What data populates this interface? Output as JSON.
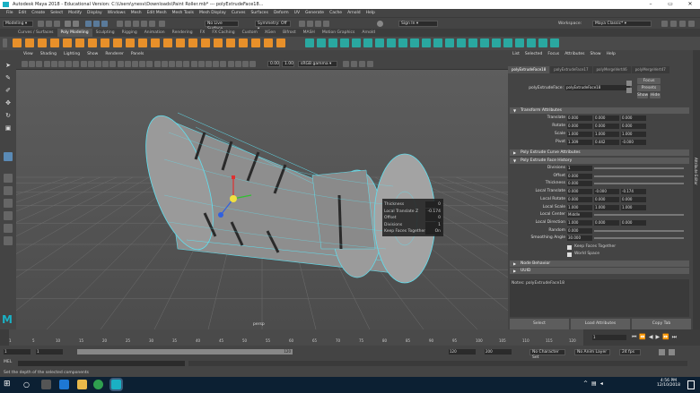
{
  "window": {
    "title": "Autodesk Maya 2018 - Educational Version: C:\\Users\\ynesv\\Downloads\\Paint Roller.mb* --- polyExtrudeFace18..."
  },
  "menubar": [
    "File",
    "Edit",
    "Create",
    "Select",
    "Modify",
    "Display",
    "Windows",
    "Mesh",
    "Edit Mesh",
    "Mesh Tools",
    "Mesh Display",
    "Curves",
    "Surfaces",
    "Deform",
    "UV",
    "Generate",
    "Cache",
    "Arnold",
    "Help"
  ],
  "statusline": {
    "mode": "Modeling",
    "no_live_surface": "No Live Surface",
    "symmetry": "Symmetry: Off",
    "sign_in": "Sign In",
    "workspace_label": "Workspace:",
    "workspace": "Maya Classic*"
  },
  "shelf_tabs": [
    "Curves / Surfaces",
    "Poly Modeling",
    "Sculpting",
    "Rigging",
    "Animation",
    "Rendering",
    "FX",
    "FX Caching",
    "Custom",
    "XGen",
    "Bifrost",
    "MASH",
    "Motion Graphics",
    "Arnold"
  ],
  "shelf_active": "Poly Modeling",
  "viewport": {
    "menu": [
      "View",
      "Shading",
      "Lighting",
      "Show",
      "Renderer",
      "Panels"
    ],
    "near_value": "0.00",
    "far_value": "1.00",
    "colorspace": "sRGB gamma",
    "camera": "persp"
  },
  "hud": {
    "rows": [
      {
        "label": "Thickness",
        "value": "0"
      },
      {
        "label": "Local Translate Z",
        "value": "-0.174"
      },
      {
        "label": "Offset",
        "value": "0"
      },
      {
        "label": "Divisions",
        "value": "1"
      },
      {
        "label": "Keep Faces Together",
        "value": "On"
      }
    ]
  },
  "attribute_editor": {
    "menu": [
      "List",
      "Selected",
      "Focus",
      "Attributes",
      "Show",
      "Help"
    ],
    "tabs": [
      "polyExtrudeFace18",
      "polyExtrudeFace17",
      "polyMergeVert46",
      "polyMergeVert47"
    ],
    "node_label": "polyExtrudeFace:",
    "node_name": "polyExtrudeFace18",
    "focus_btn": "Focus",
    "presets_btn": "Presets",
    "show_btn": "Show",
    "hide_btn": "Hide",
    "sections": {
      "transform": "Transform Attributes",
      "curve": "Poly Extrude Curve Attributes",
      "history": "Poly Extrude Face History",
      "node_behavior": "Node Behavior",
      "uuid": "UUID"
    },
    "transform_rows": [
      {
        "label": "Translate",
        "vals": [
          "0.000",
          "0.000",
          "0.000"
        ]
      },
      {
        "label": "Rotate",
        "vals": [
          "0.000",
          "0.000",
          "0.000"
        ]
      },
      {
        "label": "Scale",
        "vals": [
          "1.000",
          "1.000",
          "1.000"
        ]
      },
      {
        "label": "Pivot",
        "vals": [
          "1.309",
          "0.442",
          "-0.000"
        ]
      }
    ],
    "history_rows": [
      {
        "label": "Divisions",
        "vals": [
          "1"
        ]
      },
      {
        "label": "Offset",
        "vals": [
          "0.000"
        ]
      },
      {
        "label": "Thickness",
        "vals": [
          "0.000"
        ]
      },
      {
        "label": "Local Translate",
        "vals": [
          "0.000",
          "-0.000",
          "-0.174"
        ]
      },
      {
        "label": "Local Rotate",
        "vals": [
          "0.000",
          "0.000",
          "0.000"
        ]
      },
      {
        "label": "Local Scale",
        "vals": [
          "1.000",
          "1.000",
          "1.000"
        ]
      },
      {
        "label": "Local Center",
        "vals": [
          "Middle"
        ]
      },
      {
        "label": "Local Direction",
        "vals": [
          "1.000",
          "0.000",
          "0.000"
        ]
      },
      {
        "label": "Random",
        "vals": [
          "0.000"
        ]
      },
      {
        "label": "Smoothing Angle",
        "vals": [
          "30.000"
        ]
      }
    ],
    "keep_faces_together": "Keep Faces Together",
    "world_space": "World Space",
    "notes_label": "Notes: polyExtrudeFace18",
    "bottom_buttons": [
      "Select",
      "Load Attributes",
      "Copy Tab"
    ],
    "side_tab": "Attribute Editor"
  },
  "timeline": {
    "ticks": [
      "1",
      "5",
      "10",
      "15",
      "20",
      "25",
      "30",
      "35",
      "40",
      "45",
      "50",
      "55",
      "60",
      "65",
      "70",
      "75",
      "80",
      "85",
      "90",
      "95",
      "100",
      "105",
      "110",
      "115",
      "120"
    ],
    "current_frame": "1"
  },
  "range": {
    "start": "1",
    "inner_start": "1",
    "inner_end": "120",
    "end_a": "120",
    "end_b": "200",
    "no_char_set": "No Character Set",
    "no_anim_layer": "No Anim Layer",
    "fps": "24 fps"
  },
  "command": {
    "lang": "MEL"
  },
  "help_line": "Set the depth of the selected components",
  "taskbar": {
    "time": "4:56 PM",
    "date": "12/10/2018"
  },
  "colors": {
    "accent": "#1ab0c4",
    "wire": "#5fe0f0",
    "taskbar": "#0c2033"
  }
}
